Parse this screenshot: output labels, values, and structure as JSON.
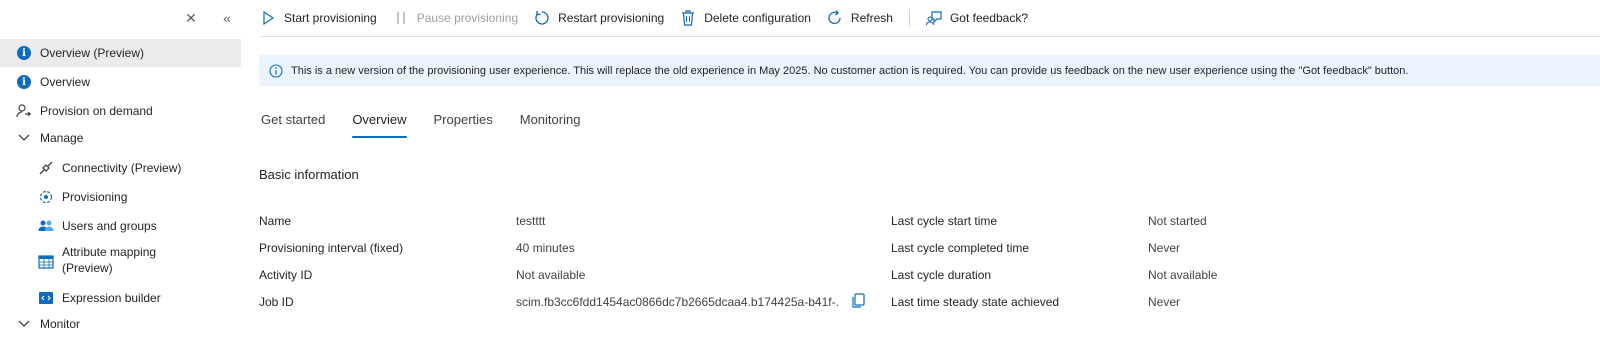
{
  "sidebar": {
    "items": [
      {
        "label": "Overview (Preview)"
      },
      {
        "label": "Overview"
      },
      {
        "label": "Provision on demand"
      },
      {
        "label": "Manage"
      },
      {
        "label": "Connectivity (Preview)"
      },
      {
        "label": "Provisioning"
      },
      {
        "label": "Users and groups"
      },
      {
        "label": "Attribute mapping (Preview)"
      },
      {
        "label": "Expression builder"
      },
      {
        "label": "Monitor"
      }
    ]
  },
  "toolbar": {
    "start": "Start provisioning",
    "pause": "Pause provisioning",
    "restart": "Restart provisioning",
    "delete": "Delete configuration",
    "refresh": "Refresh",
    "feedback": "Got feedback?"
  },
  "banner": {
    "text": "This is a new version of the provisioning user experience. This will replace the old experience in May 2025. No customer action is required. You can provide us feedback on the new user experience using the \"Got feedback\" button."
  },
  "tabs": [
    "Get started",
    "Overview",
    "Properties",
    "Monitoring"
  ],
  "section_title": "Basic information",
  "left_fields": [
    {
      "label": "Name",
      "value": "testttt"
    },
    {
      "label": "Provisioning interval (fixed)",
      "value": "40 minutes"
    },
    {
      "label": "Activity ID",
      "value": "Not available"
    },
    {
      "label": "Job ID",
      "value": "scim.fb3cc6fdd1454ac0866dc7b2665dcaa4.b174425a-b41f-..."
    }
  ],
  "right_fields": [
    {
      "label": "Last cycle start time",
      "value": "Not started"
    },
    {
      "label": "Last cycle completed time",
      "value": "Never"
    },
    {
      "label": "Last cycle duration",
      "value": "Not available"
    },
    {
      "label": "Last time steady state achieved",
      "value": "Never"
    }
  ],
  "colors": {
    "accent": "#0f6cbd",
    "banner_bg": "#ebf3fc",
    "active_item_bg": "#ebebeb"
  }
}
